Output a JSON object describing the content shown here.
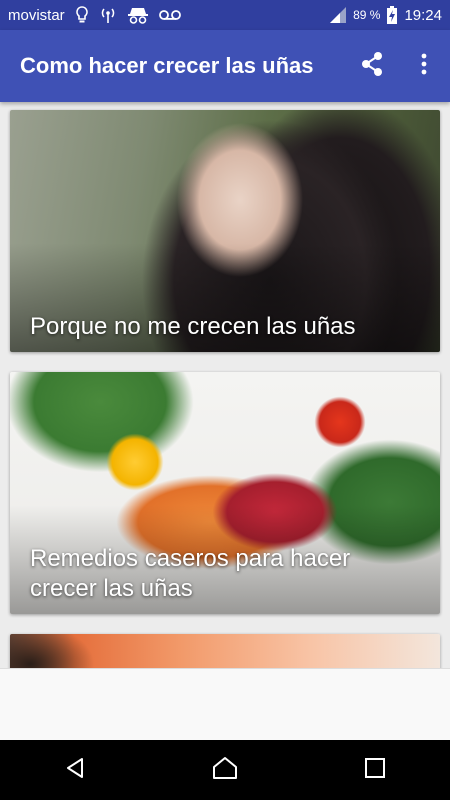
{
  "status_bar": {
    "carrier": "movistar",
    "battery": "89 %",
    "time": "19:24",
    "icons": [
      "bulb-icon",
      "hotspot-icon",
      "incognito-icon",
      "voicemail-icon",
      "signal-icon",
      "battery-charging-icon"
    ]
  },
  "app_bar": {
    "title": "Como hacer crecer las uñas",
    "actions": [
      "share-icon",
      "more-vert-icon"
    ]
  },
  "cards": [
    {
      "title": "Porque no me crecen las uñas"
    },
    {
      "title": "Remedios caseros para hacer crecer las uñas"
    },
    {
      "title": ""
    }
  ],
  "nav_bar": {
    "buttons": [
      "back-icon",
      "home-icon",
      "recents-icon"
    ]
  },
  "colors": {
    "status_bar": "#303f9f",
    "app_bar": "#3f51b5",
    "background": "#ececec"
  }
}
